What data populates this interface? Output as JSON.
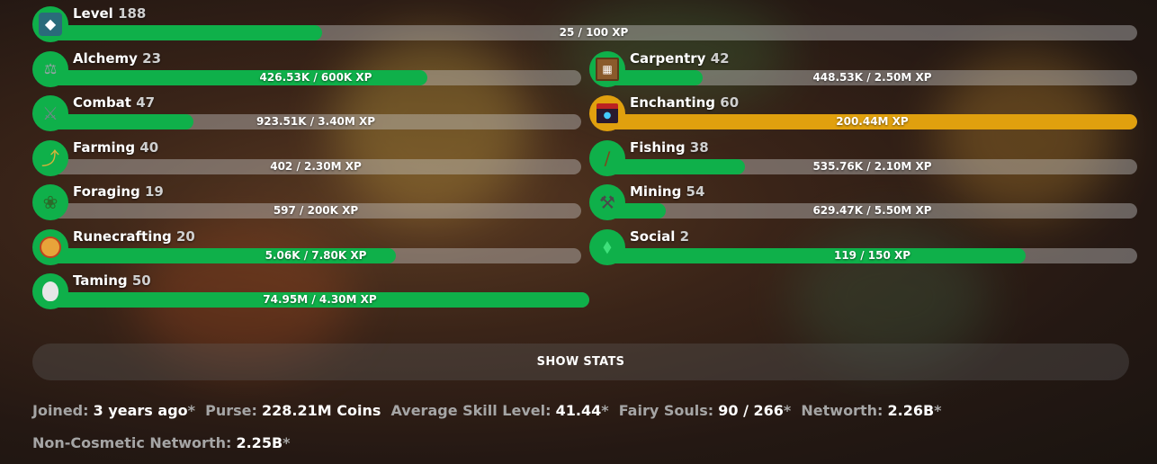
{
  "level": {
    "name": "Level",
    "level": "188",
    "xp": "25 / 100 XP",
    "progress": 0.25,
    "icon": "skyblock-level-icon",
    "color": "#0fb04a"
  },
  "skills_left": [
    {
      "name": "Alchemy",
      "level": "23",
      "xp": "426.53K / 600K XP",
      "progress": 0.71,
      "icon": "brewing-stand-icon"
    },
    {
      "name": "Combat",
      "level": "47",
      "xp": "923.51K / 3.40M XP",
      "progress": 0.27,
      "icon": "sword-icon"
    },
    {
      "name": "Farming",
      "level": "40",
      "xp": "402 / 2.30M XP",
      "progress": 0.0,
      "icon": "hoe-icon"
    },
    {
      "name": "Foraging",
      "level": "19",
      "xp": "597 / 200K XP",
      "progress": 0.0,
      "icon": "sapling-icon"
    },
    {
      "name": "Runecrafting",
      "level": "20",
      "xp": "5.06K / 7.80K XP",
      "progress": 0.65,
      "icon": "magma-cream-icon"
    },
    {
      "name": "Taming",
      "level": "50",
      "xp": "74.95M / 4.30M XP",
      "progress": 1.0,
      "icon": "spawn-egg-icon"
    }
  ],
  "skills_right": [
    {
      "name": "Carpentry",
      "level": "42",
      "xp": "448.53K / 2.50M XP",
      "progress": 0.18,
      "icon": "crafting-table-icon"
    },
    {
      "name": "Enchanting",
      "level": "60",
      "xp": "200.44M XP",
      "progress": 1.0,
      "icon": "enchanting-table-icon",
      "maxed": true
    },
    {
      "name": "Fishing",
      "level": "38",
      "xp": "535.76K / 2.10M XP",
      "progress": 0.26,
      "icon": "fishing-rod-icon"
    },
    {
      "name": "Mining",
      "level": "54",
      "xp": "629.47K / 5.50M XP",
      "progress": 0.11,
      "icon": "pickaxe-icon"
    },
    {
      "name": "Social",
      "level": "2",
      "xp": "119 / 150 XP",
      "progress": 0.79,
      "icon": "emerald-icon"
    }
  ],
  "show_stats_label": "SHOW STATS",
  "stats": [
    {
      "key": "Joined:",
      "value": "3 years ago",
      "asterisk": "*"
    },
    {
      "key": "Purse:",
      "value": "228.21M Coins",
      "asterisk": ""
    },
    {
      "key": "Average Skill Level:",
      "value": "41.44",
      "asterisk": "*"
    },
    {
      "key": "Fairy Souls:",
      "value": "90 / 266",
      "asterisk": "*"
    },
    {
      "key": "Networth:",
      "value": "2.26B",
      "asterisk": "*"
    },
    {
      "key": "Non-Cosmetic Networth:",
      "value": "2.25B",
      "asterisk": "*"
    }
  ],
  "colors": {
    "green": "#0fb04a",
    "gold": "#e0a00e",
    "muted": "#a5a5a5"
  }
}
